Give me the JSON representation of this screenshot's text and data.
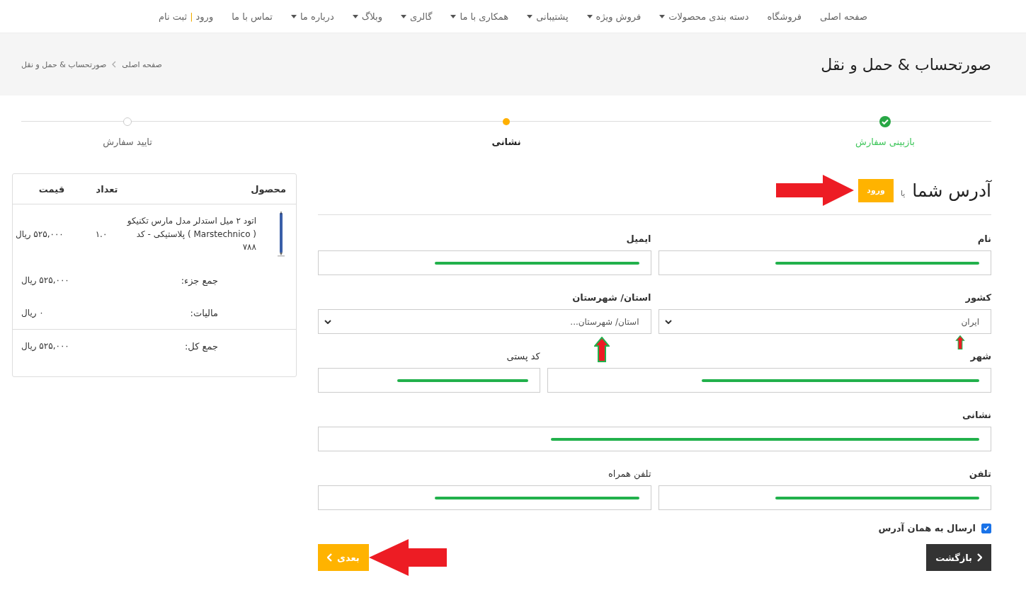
{
  "nav": [
    {
      "label": "صفحه اصلی",
      "dropdown": false
    },
    {
      "label": "فروشگاه",
      "dropdown": false
    },
    {
      "label": "دسته بندی محصولات",
      "dropdown": true
    },
    {
      "label": "فروش ویژه",
      "dropdown": true
    },
    {
      "label": "پشتیبانی",
      "dropdown": true
    },
    {
      "label": "همکاری با ما",
      "dropdown": true
    },
    {
      "label": "گالری",
      "dropdown": true
    },
    {
      "label": "وبلاگ",
      "dropdown": true
    },
    {
      "label": "درباره ما",
      "dropdown": true
    },
    {
      "label": "تماس با ما",
      "dropdown": false
    }
  ],
  "auth": {
    "login": "ورود",
    "separator": "|",
    "register": "ثبت نام"
  },
  "page_title": "صورتحساب & حمل و نقل",
  "breadcrumb": [
    "صفحه اصلی",
    "صورتحساب & حمل و نقل"
  ],
  "steps": [
    {
      "label": "بازبینی سفارش",
      "completed": true,
      "selected": false
    },
    {
      "label": "نشانی",
      "completed": false,
      "selected": true
    },
    {
      "label": "تایید سفارش",
      "completed": false,
      "selected": false
    }
  ],
  "form": {
    "title": "آدرس شما",
    "or": "یا",
    "login_button": "ورود",
    "rows": [
      [
        {
          "label": "نام",
          "strong": true,
          "kind": "text"
        },
        {
          "label": "ایمیل",
          "strong": true,
          "kind": "text"
        }
      ],
      [
        {
          "label": "کشور",
          "strong": true,
          "kind": "select",
          "value": "ایران"
        },
        {
          "label": "استان/ شهرستان",
          "strong": true,
          "kind": "select",
          "value": "استان/ شهرستان..."
        }
      ],
      [
        {
          "label": "شهر",
          "strong": true,
          "kind": "text"
        },
        {
          "label": "کد پستی",
          "strong": false,
          "kind": "text"
        }
      ],
      [
        {
          "label": "نشانی",
          "strong": true,
          "kind": "text"
        }
      ],
      [
        {
          "label": "تلفن",
          "strong": true,
          "kind": "text"
        },
        {
          "label": "تلفن همراه",
          "strong": false,
          "kind": "text"
        }
      ]
    ],
    "same_address": {
      "label": "ارسال به همان آدرس",
      "checked": true
    },
    "back_button": "بازگشت",
    "next_button": "بعدی"
  },
  "cart": {
    "columns": [
      "محصول",
      "تعداد",
      "قیمت"
    ],
    "items": [
      {
        "name": "اتود ۲ میل استدلر مدل مارس تکنیکو ( Marstechnico ) پلاستیکی - کد ۷۸۸",
        "qty": "۱.۰",
        "price": "۵۲۵,۰۰۰ ریال"
      }
    ],
    "subtotal": {
      "label": "جمع جزء:",
      "value": "۵۲۵,۰۰۰ ریال"
    },
    "tax": {
      "label": "مالیات:",
      "value": "۰ ریال"
    },
    "total": {
      "label": "جمع کل:",
      "value": "۵۲۵,۰۰۰ ریال"
    }
  }
}
